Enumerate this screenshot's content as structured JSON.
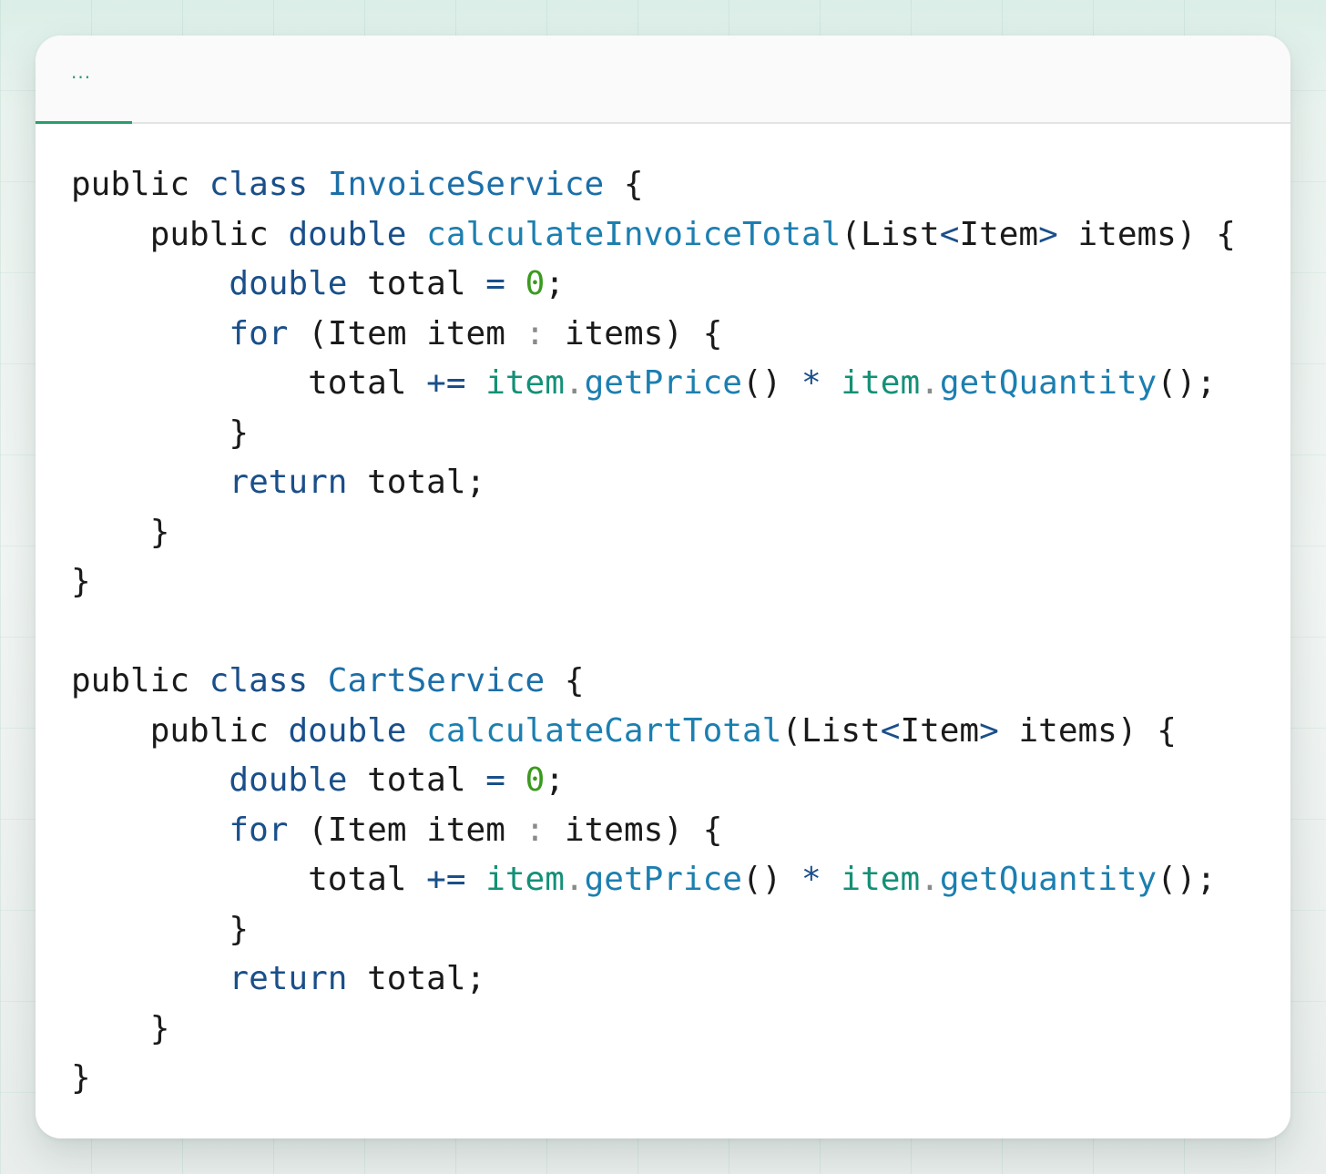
{
  "tab": {
    "label": "..."
  },
  "code": {
    "language": "java",
    "lines": [
      "public class InvoiceService {",
      "    public double calculateInvoiceTotal(List<Item> items) {",
      "        double total = 0;",
      "        for (Item item : items) {",
      "            total += item.getPrice() * item.getQuantity();",
      "        }",
      "        return total;",
      "    }",
      "}",
      "",
      "public class CartService {",
      "    public double calculateCartTotal(List<Item> items) {",
      "        double total = 0;",
      "        for (Item item : items) {",
      "            total += item.getPrice() * item.getQuantity();",
      "        }",
      "        return total;",
      "    }",
      "}"
    ]
  },
  "colors": {
    "accent": "#2a9d6f",
    "keyword": "#1a4f8a",
    "type_name": "#1c6fa8",
    "number": "#3a9a1e",
    "object": "#149077"
  }
}
